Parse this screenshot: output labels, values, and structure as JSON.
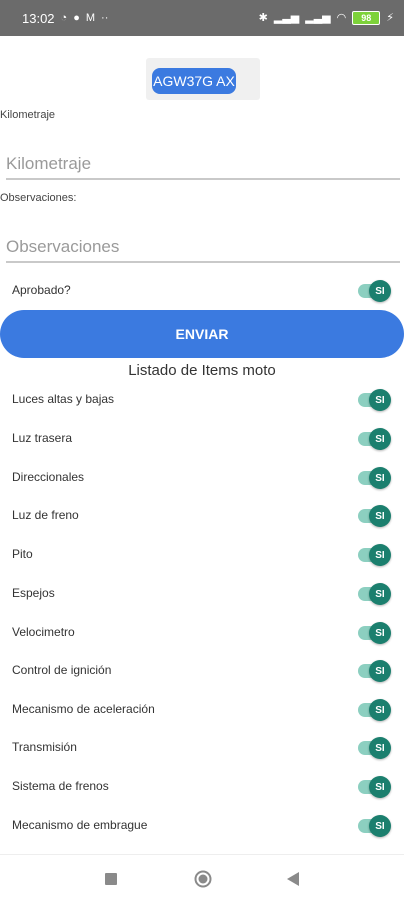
{
  "status_bar": {
    "time": "13:02",
    "battery": "98"
  },
  "plate": {
    "label": "AGW37G AX"
  },
  "kilometraje": {
    "label": "Kilometraje",
    "placeholder": "Kilometraje"
  },
  "observaciones": {
    "label": "Observaciones:",
    "placeholder": "Observaciones"
  },
  "aprobado": {
    "label": "Aprobado?",
    "switch_text": "SI"
  },
  "submit_label": "ENVIAR",
  "list_title": "Listado de Items moto",
  "items": [
    {
      "label": "Luces altas y bajas",
      "switch_text": "SI"
    },
    {
      "label": "Luz trasera",
      "switch_text": "SI"
    },
    {
      "label": "Direccionales",
      "switch_text": "SI"
    },
    {
      "label": "Luz de freno",
      "switch_text": "SI"
    },
    {
      "label": "Pito",
      "switch_text": "SI"
    },
    {
      "label": "Espejos",
      "switch_text": "SI"
    },
    {
      "label": "Velocimetro",
      "switch_text": "SI"
    },
    {
      "label": "Control de ignición",
      "switch_text": "SI"
    },
    {
      "label": "Mecanismo de aceleración",
      "switch_text": "SI"
    },
    {
      "label": "Transmisión",
      "switch_text": "SI"
    },
    {
      "label": "Sistema de frenos",
      "switch_text": "SI"
    },
    {
      "label": "Mecanismo de embrague",
      "switch_text": "SI"
    }
  ],
  "colors": {
    "accent": "#3b7ae0",
    "switch_knob": "#1b7f6e",
    "switch_track": "#8ccfc0"
  }
}
